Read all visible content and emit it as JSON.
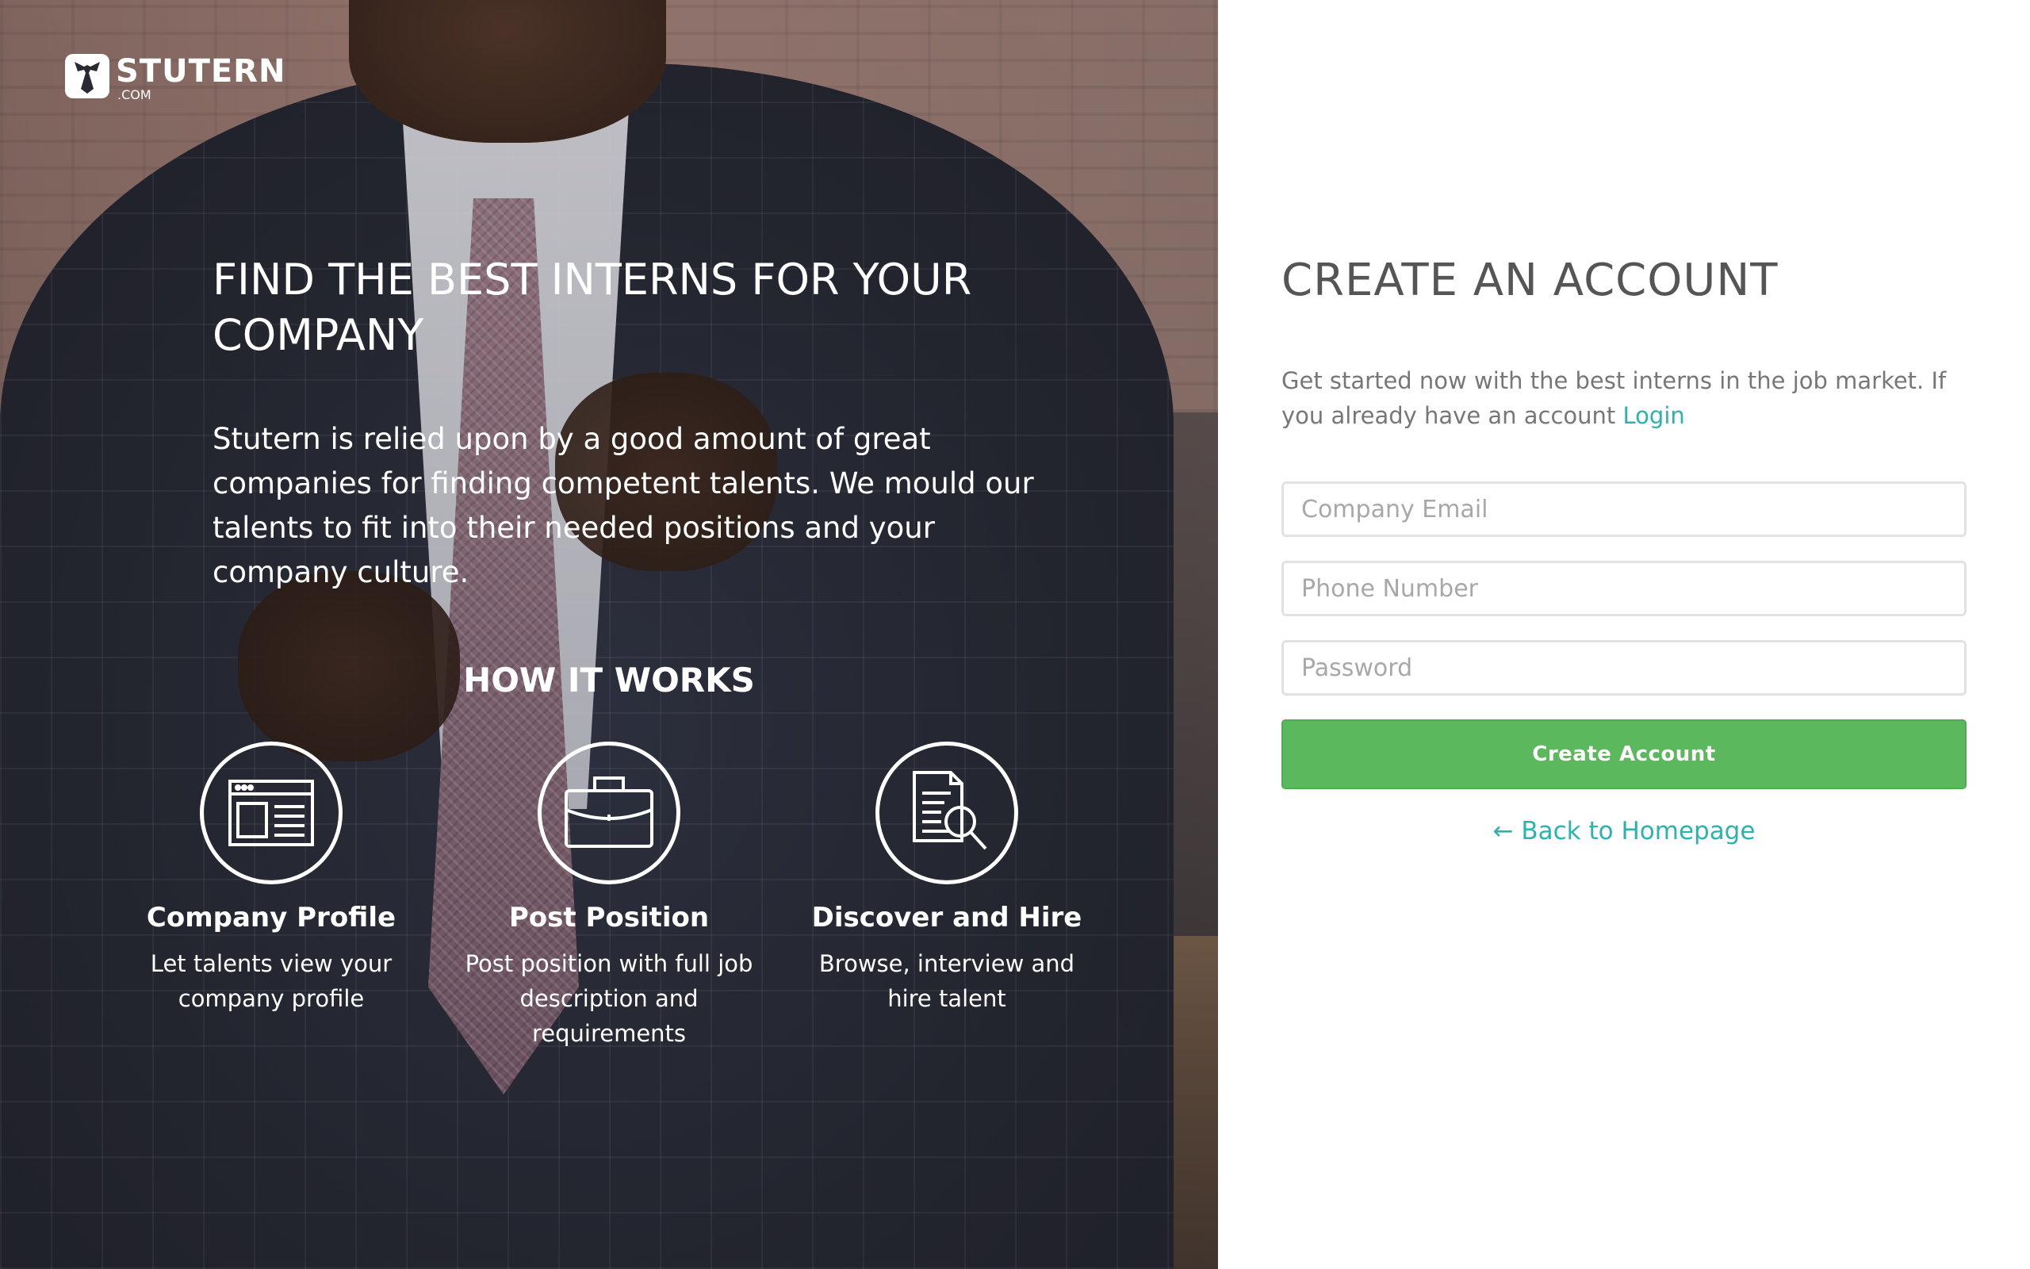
{
  "brand": {
    "name": "STUTERN",
    "suffix": ".COM"
  },
  "hero": {
    "title": "FIND THE BEST INTERNS FOR YOUR COMPANY",
    "description": "Stutern is relied upon by a good amount of great companies for finding competent talents. We mould our talents to fit into their needed positions and your company culture.",
    "how_title": "HOW IT WORKS",
    "steps": [
      {
        "icon": "browser-window-icon",
        "title": "Company Profile",
        "description": "Let talents view your company profile"
      },
      {
        "icon": "briefcase-icon",
        "title": "Post Position",
        "description": "Post position with full job description and requirements"
      },
      {
        "icon": "document-search-icon",
        "title": "Discover and Hire",
        "description": "Browse, interview and hire talent"
      }
    ]
  },
  "form": {
    "title": "CREATE AN ACCOUNT",
    "description": "Get started now with the best interns in the job market. If you already have an account",
    "login_label": "Login",
    "email_placeholder": "Company Email",
    "phone_placeholder": "Phone Number",
    "password_placeholder": "Password",
    "submit_label": "Create Account",
    "back_label": "← Back to Homepage"
  },
  "colors": {
    "accent": "#2bb3ad",
    "button": "#5cb85c",
    "title_text": "#555555"
  }
}
